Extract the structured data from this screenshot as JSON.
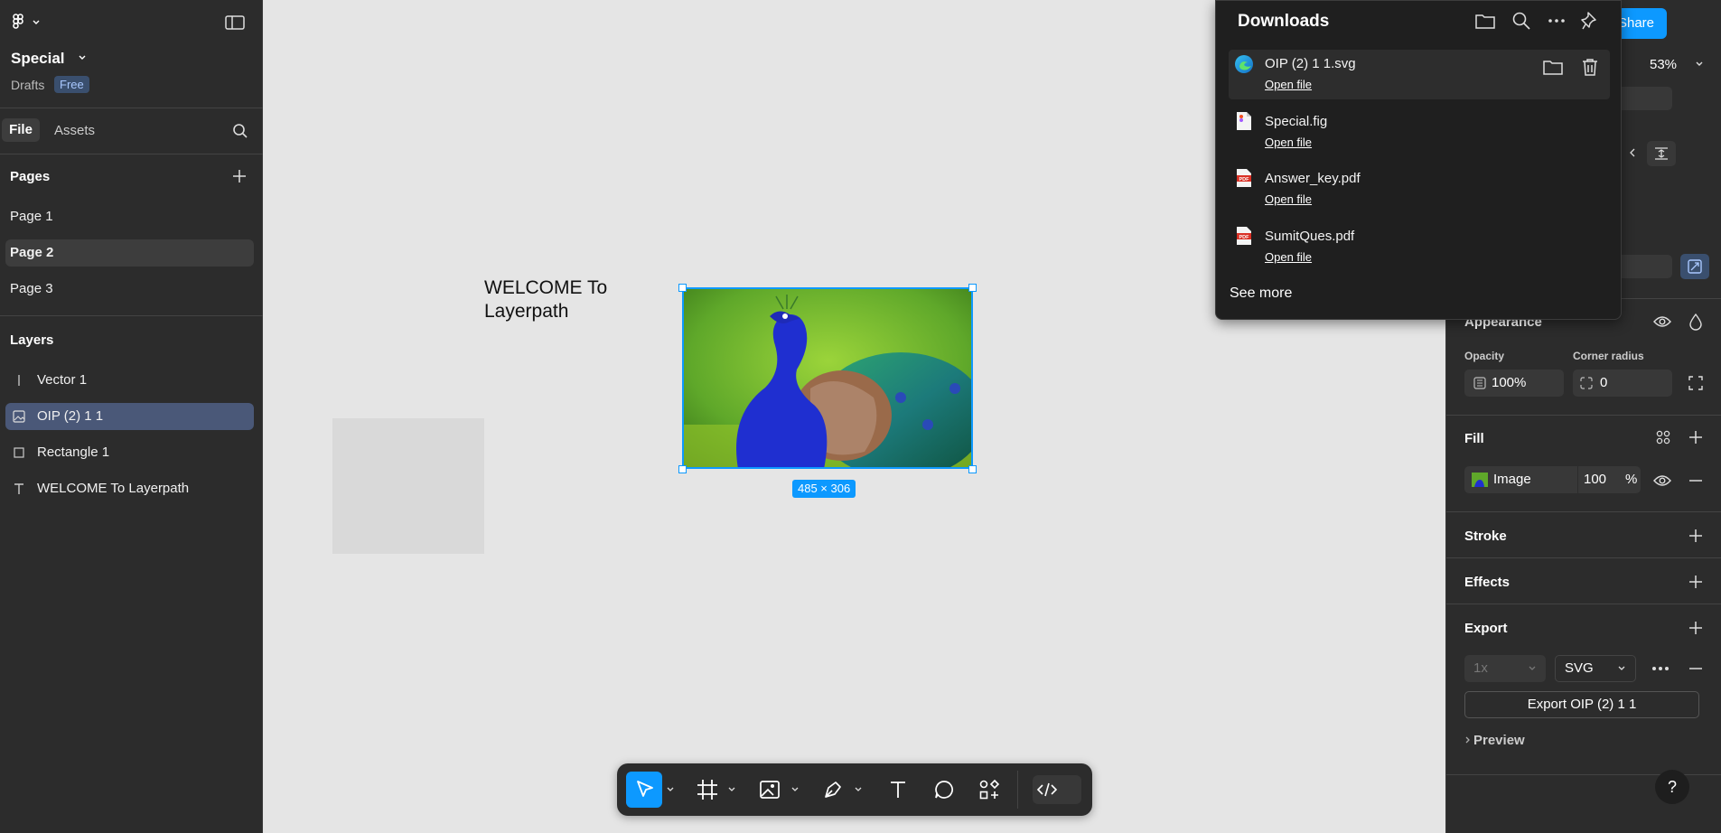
{
  "file": {
    "name": "Special",
    "location": "Drafts",
    "plan_badge": "Free"
  },
  "left_tabs": {
    "file": "File",
    "assets": "Assets"
  },
  "pages": {
    "heading": "Pages",
    "items": [
      "Page 1",
      "Page 2",
      "Page 3"
    ],
    "selected": "Page 2"
  },
  "layers": {
    "heading": "Layers",
    "items": [
      "Vector 1",
      "OIP (2) 1 1",
      "Rectangle 1",
      "WELCOME To Layerpath"
    ],
    "selected": "OIP (2) 1 1"
  },
  "canvas": {
    "welcome_text_line1": "WELCOME To",
    "welcome_text_line2": "Layerpath",
    "image_size_label": "485 × 306"
  },
  "header": {
    "share_label": "Share",
    "zoom": "53%"
  },
  "downloads": {
    "title": "Downloads",
    "items": [
      {
        "name": "OIP (2) 1 1.svg",
        "action": "Open file",
        "icon": "edge-icon"
      },
      {
        "name": "Special.fig",
        "action": "Open file",
        "icon": "figma-file-icon"
      },
      {
        "name": "Answer_key.pdf",
        "action": "Open file",
        "icon": "pdf-icon"
      },
      {
        "name": "SumitQues.pdf",
        "action": "Open file",
        "icon": "pdf-icon"
      }
    ],
    "see_more": "See more"
  },
  "appearance": {
    "heading": "Appearance",
    "opacity_label": "Opacity",
    "opacity_value": "100%",
    "corner_radius_label": "Corner radius",
    "corner_radius_value": "0"
  },
  "fill": {
    "heading": "Fill",
    "type": "Image",
    "opacity": "100",
    "unit": "%"
  },
  "stroke": {
    "heading": "Stroke"
  },
  "effects": {
    "heading": "Effects"
  },
  "export": {
    "heading": "Export",
    "scale": "1x",
    "format": "SVG",
    "button": "Export OIP (2) 1 1",
    "preview": "Preview"
  },
  "help": {
    "label": "?"
  },
  "colors": {
    "accent": "#0d99ff",
    "panel": "#2c2c2c",
    "canvas": "#e5e5e5",
    "selected_layer": "#4a5878"
  }
}
